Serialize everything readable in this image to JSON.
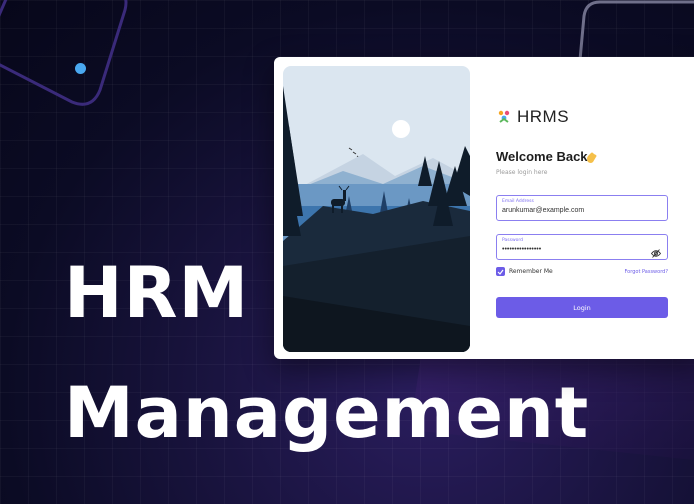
{
  "headline": {
    "line1": "HRM",
    "line2": "Management"
  },
  "login": {
    "brand": "HRMS",
    "welcome": "Welcome Back",
    "subtitle": "Please login here",
    "email_label": "Email Address",
    "email_value": "arunkumar@example.com",
    "password_label": "Password",
    "password_value": "••••••••••••••••",
    "remember_label": "Remember Me",
    "forgot_label": "Forgot Password?",
    "login_label": "Login"
  },
  "colors": {
    "accent": "#6c5ce7",
    "background": "#0b0b24",
    "card": "#ffffff"
  },
  "icons": [
    "hrms-logo-icon",
    "waving-hand-icon",
    "eye-off-icon",
    "checkbox-checked-icon"
  ]
}
